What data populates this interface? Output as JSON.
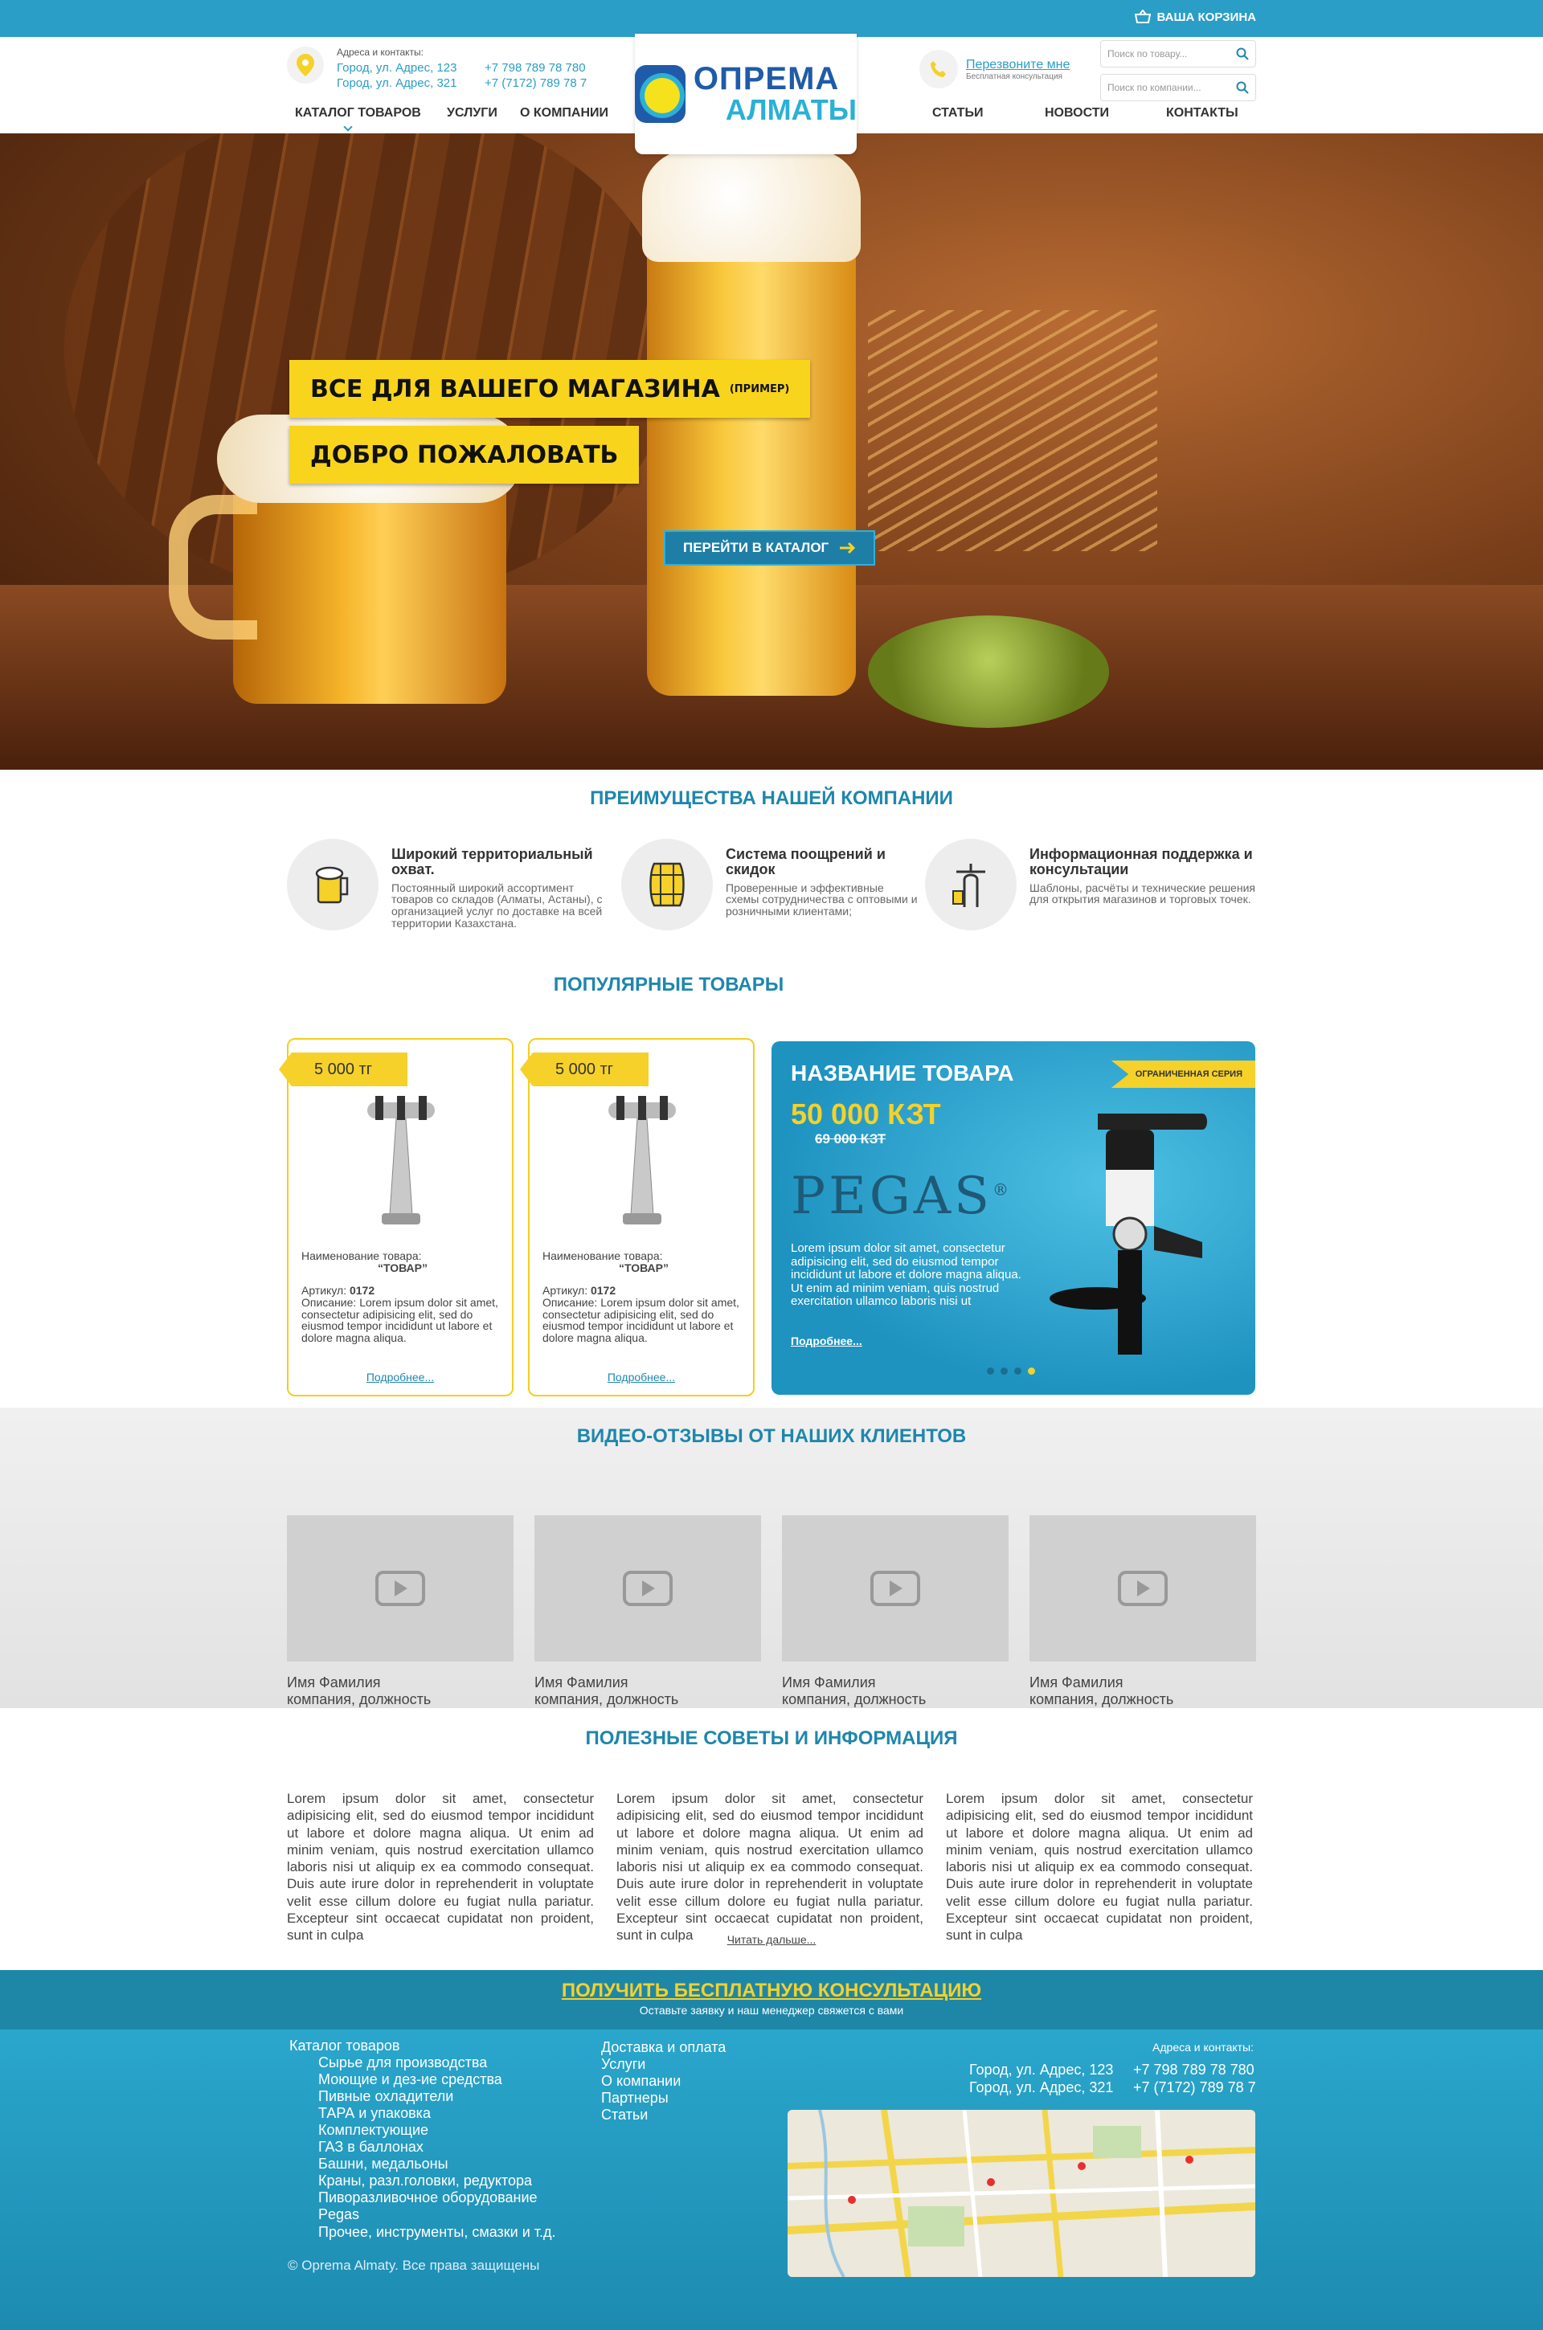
{
  "topbar": {
    "cart_label": "ВАША КОРЗИНА"
  },
  "header": {
    "contacts_title": "Адреса и контакты:",
    "address1": "Город, ул. Адрес, 123",
    "phone1": "+7 798 789 78 780",
    "address2": "Город, ул. Адрес, 321",
    "phone2": "+7 (7172) 789 78 7",
    "logo_line1": "ОПРЕМА",
    "logo_line2": "АЛМАТЫ",
    "callback_link": "Перезвоните мне",
    "callback_sub": "Бесплатная консультация",
    "search_product_placeholder": "Поиск по товару...",
    "search_company_placeholder": "Поиск по компании...",
    "nav": [
      "КАТАЛОГ ТОВАРОВ",
      "УСЛУГИ",
      "О КОМПАНИИ",
      "СТАТЬИ",
      "НОВОСТИ",
      "КОНТАКТЫ"
    ]
  },
  "hero": {
    "line1": "ВСЕ ДЛЯ ВАШЕГО МАГАЗИНА",
    "line1_note": "(ПРИМЕР)",
    "line2": "ДОБРО ПОЖАЛОВАТЬ",
    "button": "ПЕРЕЙТИ В КАТАЛОГ"
  },
  "advantages": {
    "title": "ПРЕИМУЩЕСТВА НАШЕЙ КОМПАНИИ",
    "items": [
      {
        "title": "Широкий территориальный охват.",
        "text": "Постоянный широкий ассортимент товаров со складов (Алматы, Астаны), с организацией услуг по доставке на всей территории Казахстана.",
        "icon": "beer-mug-icon"
      },
      {
        "title": "Система поощрений и скидок",
        "text": "Проверенные и эффективные схемы сотрудничества с оптовыми и розничными клиентами;",
        "icon": "barrel-icon"
      },
      {
        "title": "Информационная поддержка и консультации",
        "text": "Шаблоны, расчёты и технические решения для открытия магазинов и торговых точек.",
        "icon": "beer-tap-icon"
      }
    ]
  },
  "popular": {
    "title": "ПОПУЛЯРНЫЕ ТОВАРЫ",
    "cards": [
      {
        "price": "5 000 тг",
        "name_label": "Наименование товара:",
        "name": "“ТОВАР”",
        "article_label": "Артикул:",
        "article": "0172",
        "desc": "Описание: Lorem ipsum dolor sit amet, consectetur adipisicing elit, sed do eiusmod tempor incididunt ut labore et dolore magna aliqua.",
        "more": "Подробнее..."
      },
      {
        "price": "5 000 тг",
        "name_label": "Наименование товара:",
        "name": "“ТОВАР”",
        "article_label": "Артикул:",
        "article": "0172",
        "desc": "Описание: Lorem ipsum dolor sit amet, consectetur adipisicing elit, sed do eiusmod tempor incididunt ut labore et dolore magna aliqua.",
        "more": "Подробнее..."
      }
    ],
    "promo": {
      "ribbon": "ОГРАНИЧЕННАЯ СЕРИЯ",
      "name": "НАЗВАНИЕ ТОВАРА",
      "price": "50 000 КЗТ",
      "old_price": "69 000 КЗТ",
      "brand": "PEGAS",
      "brand_mark": "®",
      "desc": "Lorem ipsum dolor sit amet, consectetur adipisicing elit, sed do eiusmod tempor incididunt ut labore et dolore magna aliqua. Ut enim ad minim veniam, quis nostrud exercitation ullamco laboris nisi ut",
      "more": "Подробнее...",
      "slides_total": 4,
      "active_slide": 4
    }
  },
  "videos": {
    "title": "ВИДЕО-ОТЗЫВЫ ОТ НАШИХ КЛИЕНТОВ",
    "items": [
      {
        "name": "Имя Фамилия",
        "role": "компания, должность"
      },
      {
        "name": "Имя Фамилия",
        "role": "компания, должность"
      },
      {
        "name": "Имя Фамилия",
        "role": "компания, должность"
      },
      {
        "name": "Имя Фамилия",
        "role": "компания, должность"
      }
    ]
  },
  "tips": {
    "title": "ПОЛЕЗНЫЕ СОВЕТЫ И ИНФОРМАЦИЯ",
    "columns": [
      "Lorem ipsum dolor sit amet, consectetur adipisicing elit, sed do eiusmod tempor incididunt ut labore et dolore magna aliqua. Ut enim ad minim veniam, quis nostrud exercitation ullamco laboris nisi ut aliquip ex ea commodo consequat. Duis aute irure dolor in reprehenderit in voluptate velit esse cillum dolore eu fugiat nulla pariatur. Excepteur sint occaecat cupidatat non proident, sunt in culpa",
      "Lorem ipsum dolor sit amet, consectetur adipisicing elit, sed do eiusmod tempor incididunt ut labore et dolore magna aliqua. Ut enim ad minim veniam, quis nostrud exercitation ullamco laboris nisi ut aliquip ex ea commodo consequat. Duis aute irure dolor in reprehenderit in voluptate velit esse cillum dolore eu fugiat nulla pariatur. Excepteur sint occaecat cupidatat non proident, sunt in culpa",
      "Lorem ipsum dolor sit amet, consectetur adipisicing elit, sed do eiusmod tempor incididunt ut labore et dolore magna aliqua. Ut enim ad minim veniam, quis nostrud exercitation ullamco laboris nisi ut aliquip ex ea commodo consequat. Duis aute irure dolor in reprehenderit in voluptate velit esse cillum dolore eu fugiat nulla pariatur. Excepteur sint occaecat cupidatat non proident, sunt in culpa"
    ],
    "more": "Читать дальше..."
  },
  "consult": {
    "title": "ПОЛУЧИТЬ БЕСПЛАТНУЮ КОНСУЛЬТАЦИЮ",
    "sub": "Оставьте заявку и наш менеджер свяжется с вами"
  },
  "footer": {
    "catalog_title": "Каталог товаров",
    "catalog_items": [
      "Сырье для производства",
      "Моющие и дез-ие средства",
      "Пивные охладители",
      "ТАРА и упаковка",
      "Комплектующие",
      "ГАЗ в баллонах",
      "Башни, медальоны",
      "Краны, разл.головки, редуктора",
      "Пиворазливочное оборудование",
      "Pegas",
      "Прочее, инструменты, смазки и т.д."
    ],
    "links": [
      "Доставка и оплата",
      "Услуги",
      "О компании",
      "Партнеры",
      "Статьи"
    ],
    "contacts_title": "Адреса и контакты:",
    "address1": "Город, ул. Адрес, 123",
    "phone1": "+7 798 789 78 780",
    "address2": "Город, ул. Адрес, 321",
    "phone2": "+7 (7172) 789 78 7",
    "copyright": "© Oprema Almaty. Все права защищены"
  },
  "colors": {
    "accent": "#2a9ec6",
    "highlight": "#f5d12a",
    "title": "#1e87ad"
  }
}
